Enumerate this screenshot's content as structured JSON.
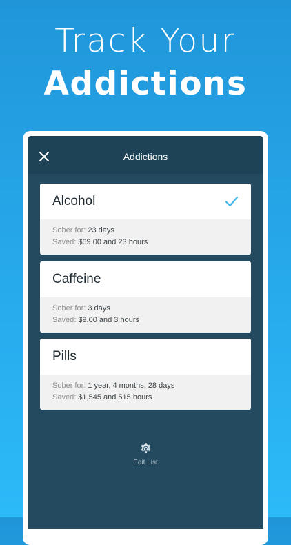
{
  "headline": {
    "line1": "Track Your",
    "line2": "Addictions"
  },
  "nav": {
    "title": "Addictions",
    "close_icon": "close-icon"
  },
  "addictions": [
    {
      "name": "Alcohol",
      "selected": true,
      "sober_label": "Sober for:",
      "sober_value": "23 days",
      "saved_label": "Saved:",
      "saved_value": "$69.00 and 23 hours"
    },
    {
      "name": "Caffeine",
      "selected": false,
      "sober_label": "Sober for:",
      "sober_value": "3 days",
      "saved_label": "Saved:",
      "saved_value": "$9.00 and 3 hours"
    },
    {
      "name": "Pills",
      "selected": false,
      "sober_label": "Sober for:",
      "sober_value": "1 year, 4 months, 28 days",
      "saved_label": "Saved:",
      "saved_value": "$1,545 and 515 hours"
    }
  ],
  "footer": {
    "edit_label": "Edit List",
    "edit_icon": "gear-icon"
  },
  "colors": {
    "background_top": "#2096d9",
    "background_bottom": "#2cbaf9",
    "screen": "#244a5f",
    "navbar": "#1f4356",
    "check": "#3fb6ea",
    "card_footer": "#f1f1f1"
  }
}
